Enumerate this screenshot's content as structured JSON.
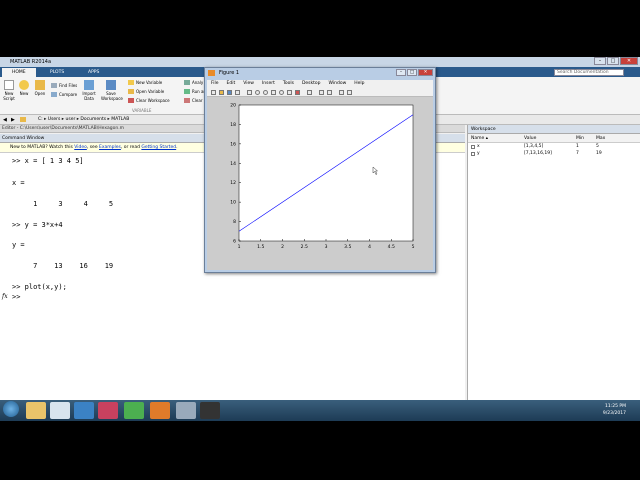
{
  "window": {
    "title": "MATLAB R2014a"
  },
  "ribbon": {
    "tabs": [
      "HOME",
      "PLOTS",
      "APPS"
    ],
    "search_placeholder": "Search Documentation",
    "buttons": {
      "new_script": "New\nScript",
      "new": "New",
      "open": "Open",
      "find_files": "Find Files",
      "compare": "Compare",
      "import_data": "Import\nData",
      "save_workspace": "Save\nWorkspace",
      "new_variable": "New Variable",
      "open_variable": "Open Variable",
      "clear_workspace": "Clear Workspace",
      "analyze": "Analy",
      "run_and": "Run an",
      "clear": "Clear",
      "variable_group": "VARIABLE"
    }
  },
  "address": {
    "path": "C:  ▸  Users  ▸  user  ▸  Documents  ▸  MATLAB"
  },
  "editor": {
    "title": "Editor - C:\\Users\\user\\Documents\\MATLAB\\Hexagon.m"
  },
  "command_window": {
    "title": "Command Window",
    "notice_pre": "New to MATLAB? Watch this ",
    "notice_video": "Video",
    "notice_mid1": ", see ",
    "notice_examples": "Examples",
    "notice_mid2": ", or read ",
    "notice_getting_started": "Getting Started",
    "notice_end": ".",
    "lines": [
      ">> x = [ 1 3 4 5]",
      "",
      "x =",
      "",
      "     1     3     4     5",
      "",
      ">> y = 3*x+4",
      "",
      "y =",
      "",
      "     7    13    16    19",
      "",
      ">> plot(x,y);"
    ],
    "fx": "fx",
    "prompt": ">>"
  },
  "workspace": {
    "title": "Workspace",
    "columns": [
      "Name ▴",
      "Value",
      "Min",
      "Max"
    ],
    "rows": [
      {
        "name": "x",
        "value": "[1,3,4,5]",
        "min": "1",
        "max": "5"
      },
      {
        "name": "y",
        "value": "[7,13,16,19]",
        "min": "7",
        "max": "19"
      }
    ]
  },
  "figure": {
    "title": "Figure 1",
    "menu": [
      "File",
      "Edit",
      "View",
      "Insert",
      "Tools",
      "Desktop",
      "Window",
      "Help"
    ]
  },
  "chart_data": {
    "type": "line",
    "x": [
      1,
      3,
      4,
      5
    ],
    "series": [
      {
        "values": [
          7,
          13,
          16,
          19
        ]
      }
    ],
    "xlim": [
      1,
      5
    ],
    "ylim": [
      6,
      20
    ],
    "xticks": [
      "1",
      "1.5",
      "2",
      "2.5",
      "3",
      "3.5",
      "4",
      "4.5",
      "5"
    ],
    "yticks": [
      "6",
      "8",
      "10",
      "12",
      "14",
      "16",
      "18",
      "20"
    ],
    "line_color": "#0000ff",
    "grid": false
  },
  "taskbar": {
    "time": "11:25 PM",
    "date": "9/23/2017"
  },
  "colors": {
    "accent": "#2a5a8c",
    "notice_bg": "#ffffe1"
  }
}
